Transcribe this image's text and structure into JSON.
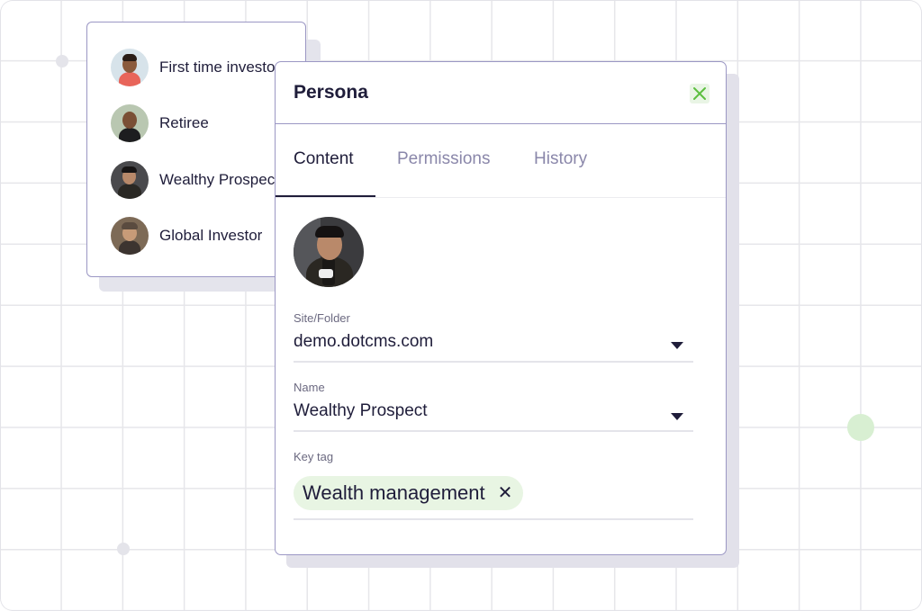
{
  "personas": [
    {
      "label": "First time investor",
      "icon": "avatar-first-time-investor"
    },
    {
      "label": "Retiree",
      "icon": "avatar-retiree"
    },
    {
      "label": "Wealthy Prospect",
      "icon": "avatar-wealthy-prospect"
    },
    {
      "label": "Global Investor",
      "icon": "avatar-global-investor"
    }
  ],
  "dialog": {
    "title": "Persona",
    "close_icon": "close-icon",
    "tabs": [
      {
        "label": "Content",
        "active": true
      },
      {
        "label": "Permissions",
        "active": false
      },
      {
        "label": "History",
        "active": false
      }
    ],
    "fields": {
      "site": {
        "label": "Site/Folder",
        "value": "demo.dotcms.com"
      },
      "name": {
        "label": "Name",
        "value": "Wealthy Prospect"
      },
      "key_tag": {
        "label": "Key tag",
        "chip": "Wealth management",
        "remove_icon": "remove-tag-icon"
      }
    }
  },
  "colors": {
    "border": "#9b97c4",
    "text": "#1f1d3a",
    "muted_tab": "#8a87aa",
    "accent_green": "#5cbf3f",
    "chip_bg": "#e8f5e3"
  }
}
